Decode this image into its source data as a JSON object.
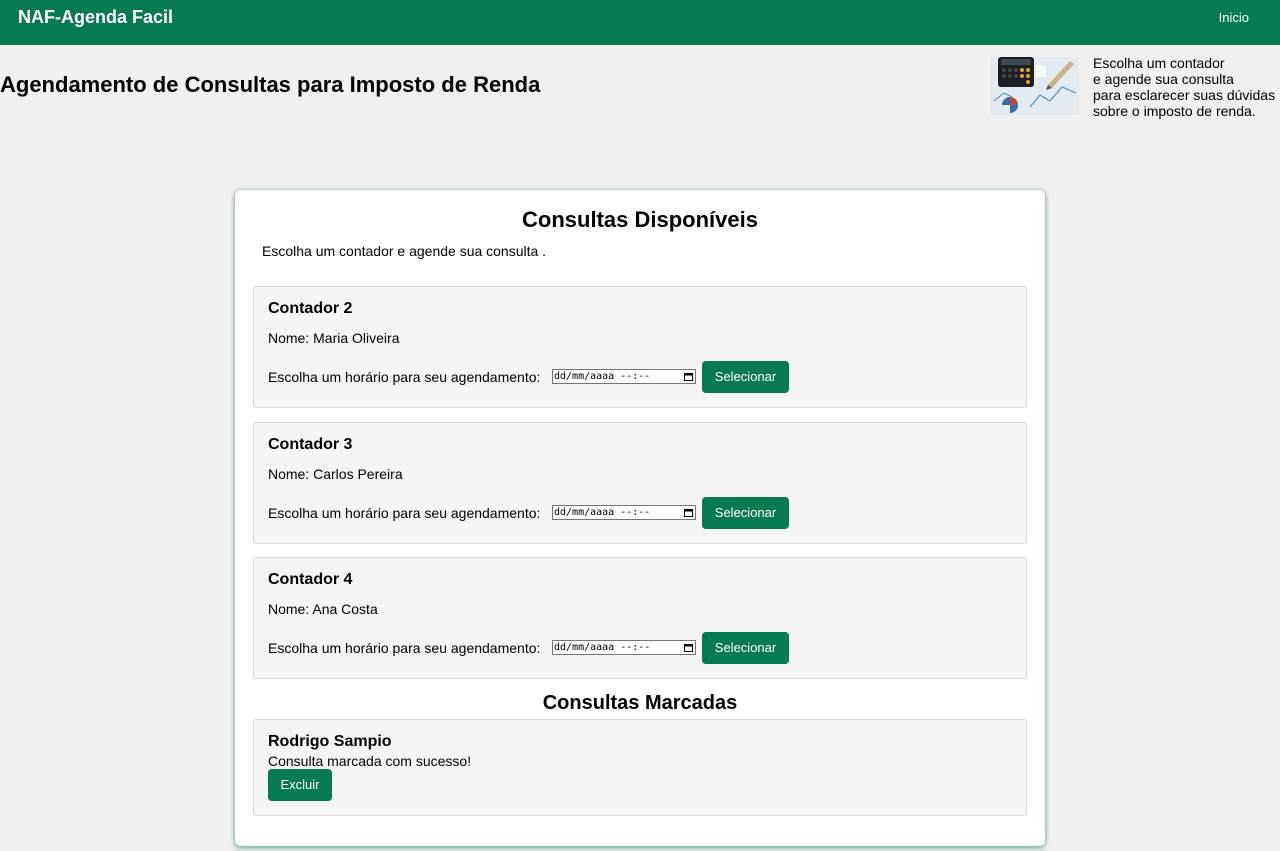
{
  "header": {
    "brand": "NAF-Agenda Facil",
    "nav_inicio": "Inicio"
  },
  "page_title": "Agendamento de Consultas para Imposto de Renda",
  "hero": {
    "lines": [
      "Escolha um contador",
      "e agende sua consulta",
      "para esclarecer suas dúvidas",
      "sobre o imposto de renda."
    ]
  },
  "available": {
    "title": "Consultas Disponíveis",
    "intro": "Escolha um contador e agende sua consulta .",
    "accountants": [
      {
        "title": "Contador 2",
        "name": "Nome: Maria Oliveira",
        "label": "Escolha um horário para seu agendamento:",
        "datetime_placeholder": "dd/mm/aaaa --:--",
        "button": "Selecionar"
      },
      {
        "title": "Contador 3",
        "name": "Nome: Carlos Pereira",
        "label": "Escolha um horário para seu agendamento:",
        "datetime_placeholder": "dd/mm/aaaa --:--",
        "button": "Selecionar"
      },
      {
        "title": "Contador 4",
        "name": "Nome: Ana Costa",
        "label": "Escolha um horário para seu agendamento:",
        "datetime_placeholder": "dd/mm/aaaa --:--",
        "button": "Selecionar"
      }
    ]
  },
  "booked": {
    "title": "Consultas Marcadas",
    "items": [
      {
        "name": "Rodrigo Sampio",
        "message": "Consulta marcada com sucesso!",
        "button": "Excluir"
      }
    ]
  },
  "colors": {
    "brand_green": "#087a52",
    "page_bg": "#f0f0f0",
    "panel_bg": "#f5f5f5"
  },
  "icons": {
    "datetime_picker": "calendar-icon",
    "hero_image": "calculator-finance-illustration"
  }
}
